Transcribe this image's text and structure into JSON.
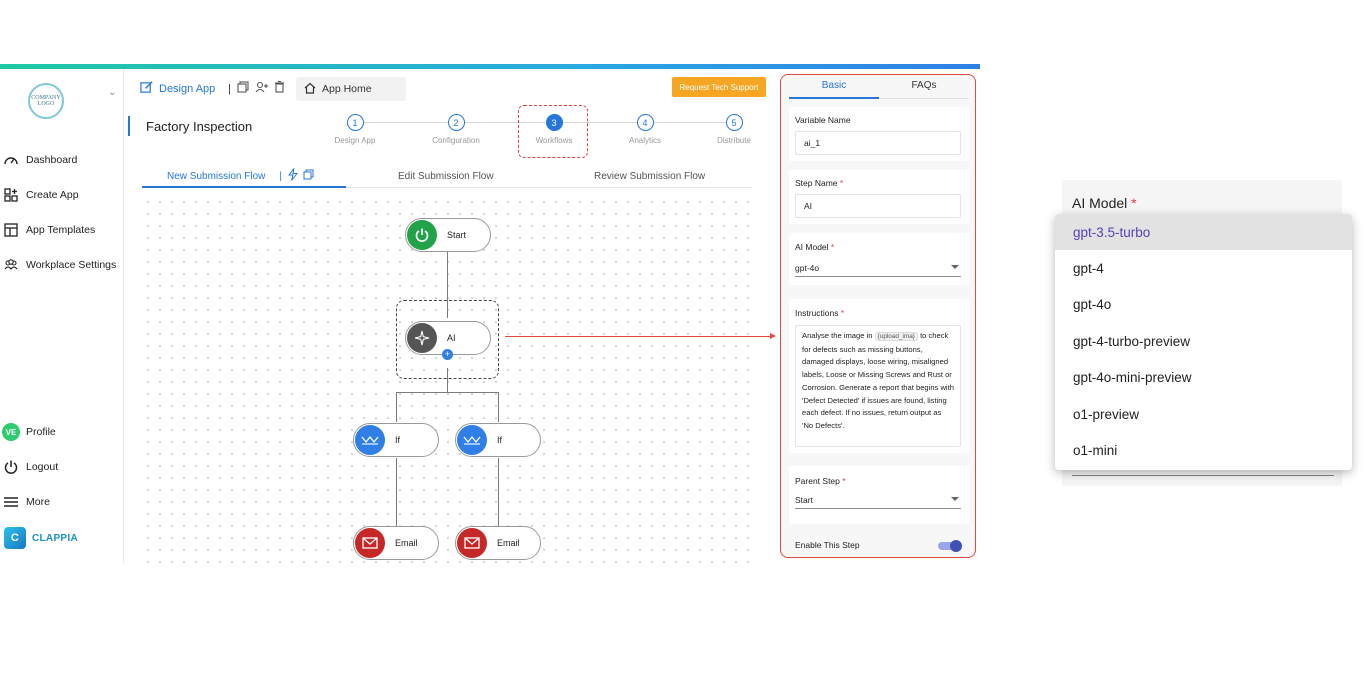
{
  "sidebar": {
    "logo_text": "COMPANY LOGO",
    "items": [
      {
        "label": "Dashboard",
        "icon": "gauge-icon"
      },
      {
        "label": "Create App",
        "icon": "grid-plus-icon"
      },
      {
        "label": "App Templates",
        "icon": "template-icon"
      },
      {
        "label": "Workplace Settings",
        "icon": "users-icon"
      }
    ],
    "bottom_items": [
      {
        "label": "Profile",
        "avatar": "VE"
      },
      {
        "label": "Logout",
        "icon": "power-icon"
      },
      {
        "label": "More",
        "icon": "menu-icon"
      }
    ],
    "brand": "CLAPPIA"
  },
  "header": {
    "design_app": "Design App",
    "app_home": "App Home",
    "support": "Request Tech Support"
  },
  "app_title": "Factory Inspection",
  "steps": [
    {
      "num": "1",
      "label": "Design App"
    },
    {
      "num": "2",
      "label": "Configuration"
    },
    {
      "num": "3",
      "label": "Workflows"
    },
    {
      "num": "4",
      "label": "Analytics"
    },
    {
      "num": "5",
      "label": "Distribute"
    }
  ],
  "flow_tabs": [
    "New Submission Flow",
    "Edit Submission Flow",
    "Review Submission Flow"
  ],
  "nodes": {
    "start": "Start",
    "ai": "AI",
    "if_left": "If",
    "if_right": "If",
    "email_left": "Email",
    "email_right": "Email"
  },
  "panel": {
    "tabs": [
      "Basic",
      "FAQs"
    ],
    "variable_name_label": "Variable Name",
    "variable_name_value": "ai_1",
    "step_name_label": "Step Name",
    "step_name_value": "AI",
    "ai_model_label": "AI Model",
    "ai_model_value": "gpt-4o",
    "instructions_label": "Instructions",
    "instructions_pre": "Analyse the image in",
    "instructions_tag": "{upload_ima}",
    "instructions_post": "to check for defects such as missing buttons, damaged displays, loose wiring, misaligned labels, Loose or Missing Screws and Rust or Corrosion. Generate a report that begins with 'Defect Detected' if issues are found, listing each defect. If no issues, return output as 'No Defects'.",
    "parent_step_label": "Parent Step",
    "parent_step_value": "Start",
    "enable_label": "Enable This Step",
    "required_mark": "*"
  },
  "dropdown": {
    "label": "AI Model",
    "options": [
      "gpt-3.5-turbo",
      "gpt-4",
      "gpt-4o",
      "gpt-4-turbo-preview",
      "gpt-4o-mini-preview",
      "o1-preview",
      "o1-mini"
    ],
    "highlighted": "gpt-3.5-turbo"
  },
  "colors": {
    "accent": "#2677d9",
    "support": "#f6a623",
    "highlight_red": "#e24b3f",
    "start_node": "#22a34a",
    "ai_node": "#555555",
    "if_node": "#2f7fe6",
    "email_node": "#c62828"
  }
}
